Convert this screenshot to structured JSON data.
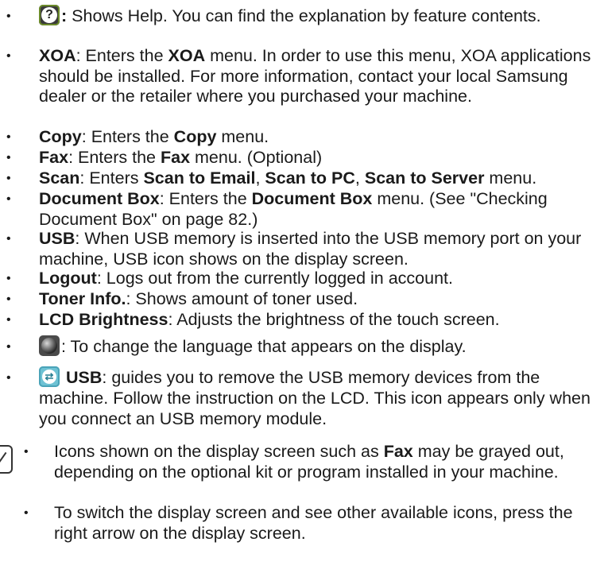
{
  "items": [
    {
      "icon": "help-icon",
      "label": ":",
      "text": "  Shows Help. You can find the explanation by feature contents."
    },
    {
      "bold": "XOA",
      "text": ": Enters the ",
      "bold2": "XOA",
      "text2": " menu. In order to use this menu, XOA applications should be installed. For more information, contact your local Samsung dealer or the retailer where you purchased your machine."
    },
    {
      "bold": "Copy",
      "text": ": Enters the ",
      "bold2": "Copy",
      "text2": " menu."
    },
    {
      "bold": "Fax",
      "text": ": Enters the ",
      "bold2": "Fax",
      "text2": " menu. (Optional)"
    },
    {
      "bold": "Scan",
      "text": ": Enters ",
      "bold2": "Scan to Email",
      "text2": ", ",
      "bold3": "Scan to PC",
      "text3": ", ",
      "bold4": "Scan to Server",
      "text4": " menu."
    },
    {
      "bold": "Document Box",
      "text": ": Enters the ",
      "bold2": "Document Box",
      "text2": " menu. (See \"Checking Document Box\" on page 82.)"
    },
    {
      "bold": "USB",
      "text": ": When USB memory is inserted into the USB memory port on your machine, USB icon shows on the display screen."
    },
    {
      "bold": "Logout",
      "text": ": Logs out from the currently logged in account."
    },
    {
      "bold": "Toner Info.",
      "text": ": Shows amount of toner used."
    },
    {
      "bold": "LCD Brightness",
      "text": ": Adjusts the brightness of the touch screen."
    },
    {
      "icon": "globe-icon",
      "text": ": To change the language that appears on the display."
    },
    {
      "icon": "usb-icon",
      "bold": "USB",
      "text": ": guides you to remove the USB memory devices from the machine. Follow the instruction on the LCD. This icon appears only when you connect an USB memory module."
    }
  ],
  "notes": [
    {
      "text": "Icons shown on the display screen such as ",
      "bold": "Fax",
      "text2": " may be grayed out, depending on the optional kit or program installed in your machine."
    },
    {
      "text": "To switch the display screen and see other available icons, press the right arrow on the display screen."
    }
  ]
}
